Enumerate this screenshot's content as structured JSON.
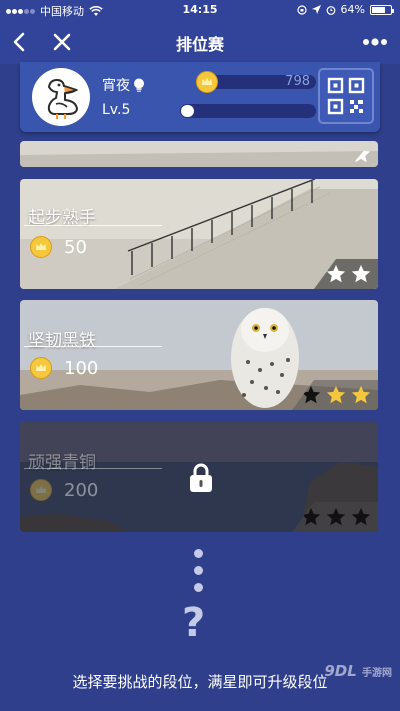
{
  "status_bar": {
    "carrier": "中国移动",
    "time": "14:15",
    "battery": "64%"
  },
  "nav": {
    "title": "排位赛",
    "icons": [
      "back-icon",
      "close-icon",
      "more-icon"
    ]
  },
  "profile": {
    "nickname": "宵夜",
    "level": "Lv.5",
    "coins": "798",
    "exp_progress": 0.1
  },
  "cards": [
    {
      "title": "",
      "points": "",
      "stars_earned": 1,
      "stars_total": 1
    },
    {
      "title": "起步熟手",
      "points": "50",
      "stars_earned": 2,
      "stars_total": 2
    },
    {
      "title": "坚韧黑铁",
      "points": "100",
      "stars_earned": 2,
      "stars_total": 3
    },
    {
      "title": "顽强青铜",
      "points": "200",
      "stars_earned": 0,
      "stars_total": 3,
      "locked": true
    }
  ],
  "more_symbol": "?",
  "hint": "选择要挑战的段位，满星即可升级段位",
  "watermark": {
    "brand": "9DL",
    "sub": "手游网"
  },
  "colors": {
    "background": "#2f3f8c",
    "panel": "#3a55ad",
    "gold": "#f5c73c"
  }
}
